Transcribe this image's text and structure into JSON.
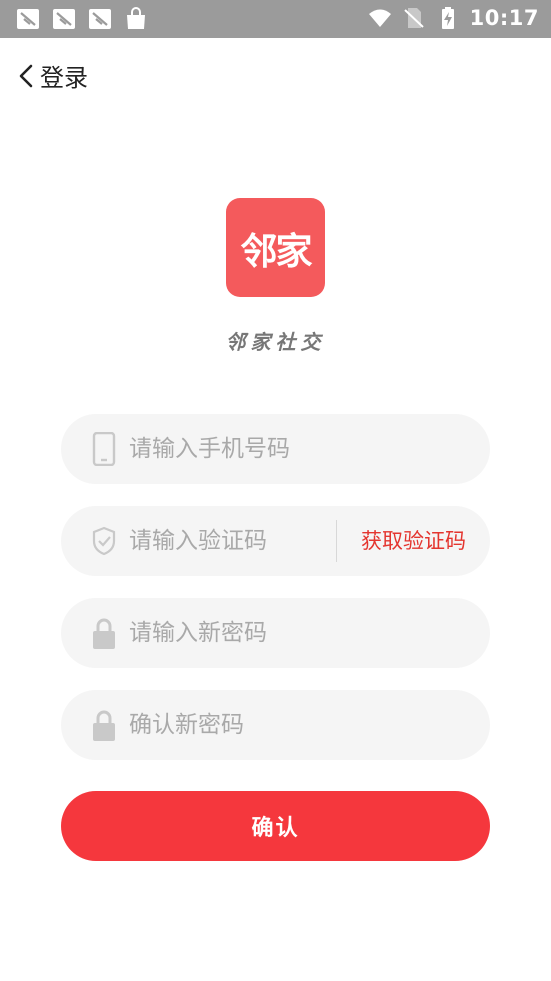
{
  "status_bar": {
    "time": "10:17",
    "icons_left": [
      "notification-icon",
      "notification-icon",
      "notification-icon",
      "shopping-bag-icon"
    ],
    "icons_right": [
      "wifi-icon",
      "no-sim-icon",
      "battery-charging-icon"
    ]
  },
  "nav": {
    "back_icon": "chevron-left-icon",
    "title": "登录"
  },
  "logo": {
    "text": "邻家",
    "bg_color": "#f45a5c"
  },
  "app_name": "邻家社交",
  "form": {
    "phone_placeholder": "请输入手机号码",
    "code_placeholder": "请输入验证码",
    "get_code_label": "获取验证码",
    "new_password_placeholder": "请输入新密码",
    "confirm_password_placeholder": "确认新密码",
    "icons": [
      "phone-icon",
      "shield-icon",
      "lock-icon",
      "lock-icon"
    ]
  },
  "confirm_button": {
    "label": "确认",
    "color": "#f5373d"
  },
  "colors": {
    "accent": "#e4352f",
    "field_bg": "#f5f5f5",
    "status_bar": "#9b9b9b"
  }
}
